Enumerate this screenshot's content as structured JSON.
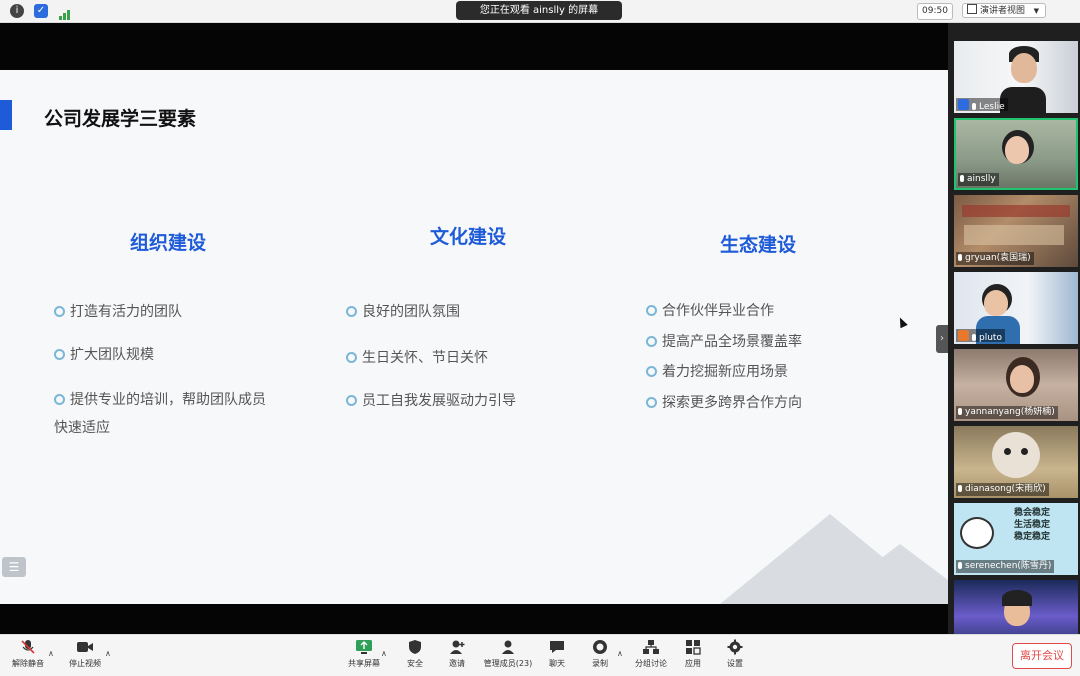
{
  "topbar": {
    "banner": "您正在观看 ainslly 的屏幕",
    "clock": "09:50",
    "view_mode": "演讲者视图"
  },
  "slide": {
    "title": "公司发展学三要素",
    "columns": [
      {
        "heading": "组织建设",
        "items": [
          "打造有活力的团队",
          "扩大团队规模",
          "提供专业的培训，帮助团队成员",
          "快速适应"
        ]
      },
      {
        "heading": "文化建设",
        "items": [
          "良好的团队氛围",
          "生日关怀、节日关怀",
          "员工自我发展驱动力引导"
        ]
      },
      {
        "heading": "生态建设",
        "items": [
          "合作伙伴异业合作",
          "提高产品全场景覆盖率",
          "着力挖掘新应用场景",
          "探索更多跨界合作方向"
        ]
      }
    ],
    "menu_glyph": "☰"
  },
  "gallery": {
    "toggle_glyph": "›",
    "participants": [
      {
        "name": "Leslie"
      },
      {
        "name": "ainslly"
      },
      {
        "name": "gryuan(袁国瑞)"
      },
      {
        "name": "pluto"
      },
      {
        "name": "yannanyang(杨妍楠)"
      },
      {
        "name": "dianasong(宋雨欣)"
      },
      {
        "name": "serenechen(陈雪丹)"
      },
      {
        "name": ""
      }
    ],
    "sticker_text": [
      "稳会稳定",
      "生活稳定",
      "稳定稳定"
    ]
  },
  "toolbar": {
    "unmute": "解除静音",
    "stop_video": "停止视频",
    "share_screen": "共享屏幕",
    "security": "安全",
    "invite": "邀请",
    "participants": "管理成员(23)",
    "chat": "聊天",
    "record": "录制",
    "breakout": "分组讨论",
    "apps": "应用",
    "settings": "设置",
    "leave": "离开会议"
  },
  "colors": {
    "accent_blue": "#1e5bd8",
    "active_speaker": "#21c46e",
    "leave_red": "#e24a4a"
  }
}
